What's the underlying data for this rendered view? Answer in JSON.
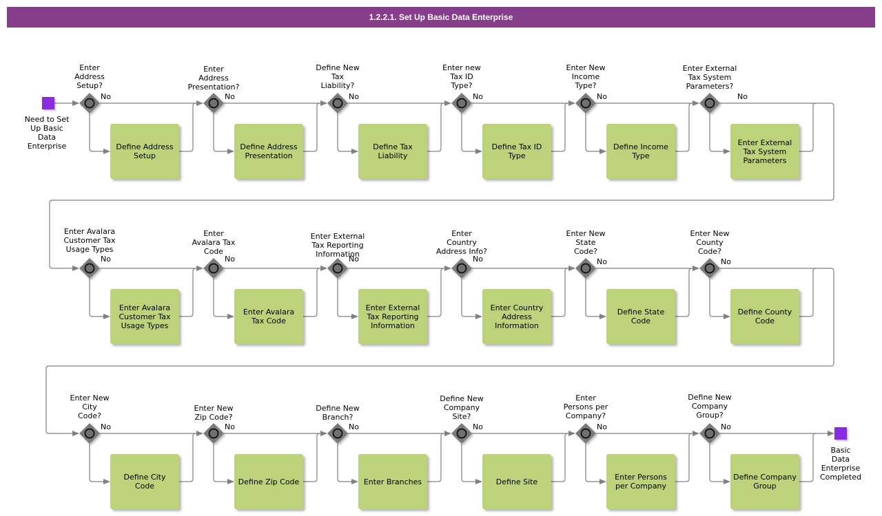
{
  "title": "1.2.2.1. Set Up Basic Data Enterprise",
  "colors": {
    "title_bar": "#863e8b",
    "task_fill": "#bdd37b",
    "event_fill": "#8a2be2",
    "gateway_fill": "#7a7a7a",
    "connector": "#808080"
  },
  "start_event": {
    "label": "Need to Set\nUp Basic\nData\nEnterprise",
    "icon": "start-event-square"
  },
  "end_event": {
    "label": "Basic\nData\nEnterprise\nCompleted",
    "icon": "end-event-square"
  },
  "no_label": "No",
  "rows": [
    {
      "steps": [
        {
          "question": "Enter\nAddress\nSetup?",
          "task": "Define Address\nSetup"
        },
        {
          "question": "Enter\nAddress\nPresentation?",
          "task": "Define Address\nPresentation"
        },
        {
          "question": "Define New\nTax\nLiability?",
          "task": "Define Tax\nLiability"
        },
        {
          "question": "Enter new\nTax ID\nType?",
          "task": "Define Tax ID\nType"
        },
        {
          "question": "Enter New\nIncome\nType?",
          "task": "Define Income\nType"
        },
        {
          "question": "Enter External\nTax System\nParameters?",
          "task": "Enter External\nTax System\nParameters"
        }
      ]
    },
    {
      "steps": [
        {
          "question": "Enter Avalara\nCustomer Tax\nUsage Types",
          "task": "Enter Avalara\nCustomer Tax\nUsage Types"
        },
        {
          "question": "Enter\nAvalara Tax\nCode",
          "task": "Enter Avalara\nTax Code"
        },
        {
          "question": "Enter External\nTax Reporting\nInformation",
          "task": "Enter External\nTax Reporting\nInformation"
        },
        {
          "question": "Enter\nCountry\nAddress Info?",
          "task": "Enter Country\nAddress\nInformation"
        },
        {
          "question": "Enter New\nState\nCode?",
          "task": "Define State\nCode"
        },
        {
          "question": "Enter New\nCounty\nCode?",
          "task": "Define County\nCode"
        }
      ]
    },
    {
      "steps": [
        {
          "question": "Enter New\nCity\nCode?",
          "task": "Define City\nCode"
        },
        {
          "question": "Enter New\nZip Code?",
          "task": "Define Zip Code"
        },
        {
          "question": "Define New\nBranch?",
          "task": "Enter Branches"
        },
        {
          "question": "Define New\nCompany\nSite?",
          "task": "Define Site"
        },
        {
          "question": "Enter\nPersons per\nCompany?",
          "task": "Enter Persons\nper Company"
        },
        {
          "question": "Define New\nCompany\nGroup?",
          "task": "Define Company\nGroup"
        }
      ]
    }
  ]
}
